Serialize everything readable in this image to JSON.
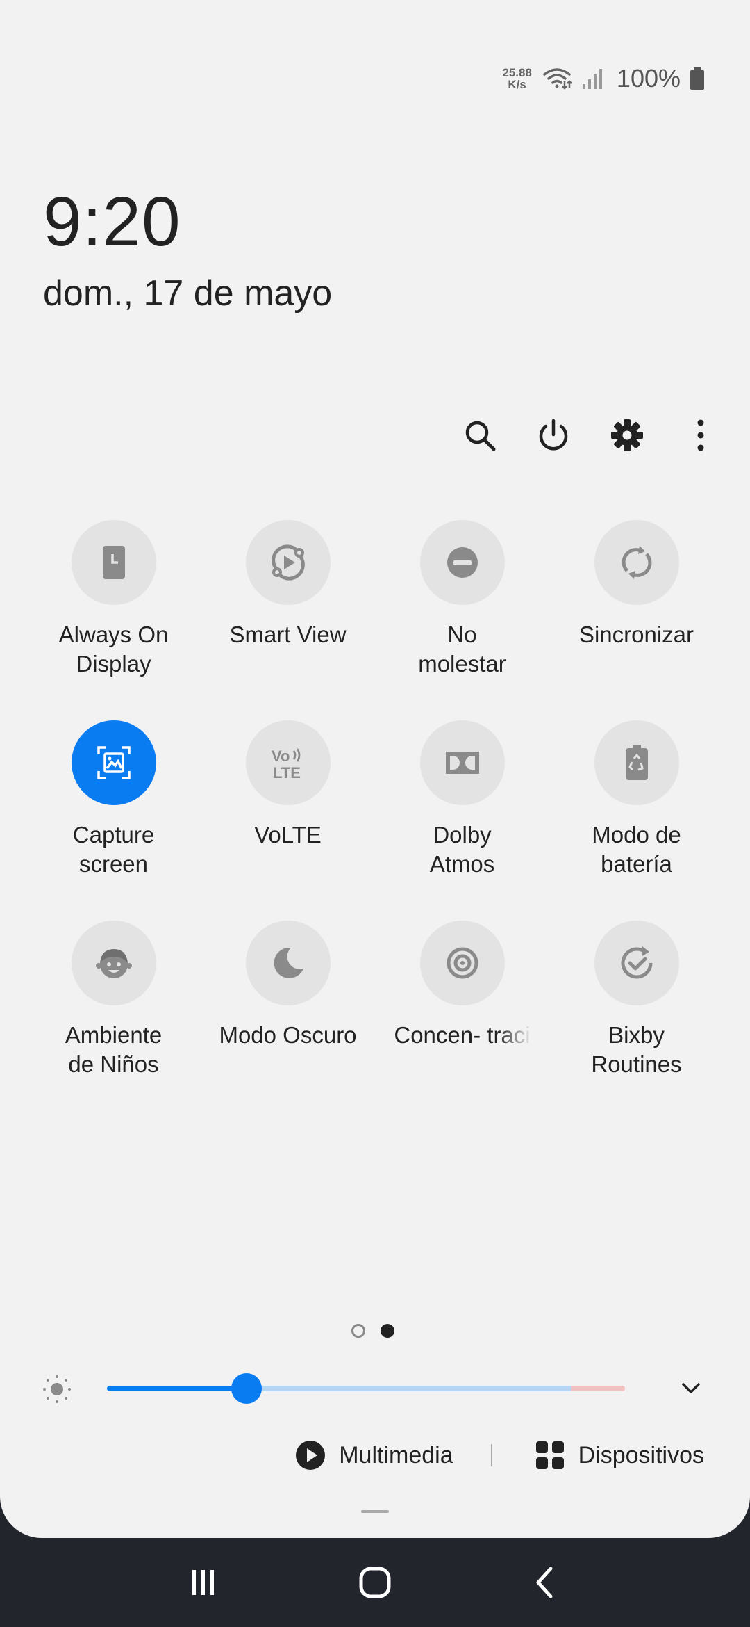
{
  "status_bar": {
    "net_speed_value": "25.88",
    "net_speed_unit": "K/s",
    "battery": "100%",
    "icons": [
      "wifi-icon",
      "signal-icon",
      "battery-icon"
    ]
  },
  "clock": {
    "time": "9:20",
    "date": "dom., 17 de mayo"
  },
  "toolbar": {
    "icons": [
      "search-icon",
      "power-icon",
      "settings-icon",
      "more-icon"
    ]
  },
  "tiles": [
    {
      "label": "Always On\nDisplay",
      "icon": "always-on-display-icon",
      "active": false
    },
    {
      "label": "Smart View",
      "icon": "smart-view-icon",
      "active": false
    },
    {
      "label": "No\nmolestar",
      "icon": "do-not-disturb-icon",
      "active": false
    },
    {
      "label": "Sincronizar",
      "icon": "sync-icon",
      "active": false
    },
    {
      "label": "Capture\nscreen",
      "icon": "capture-screen-icon",
      "active": true
    },
    {
      "label": "VoLTE",
      "icon": "volte-icon",
      "active": false
    },
    {
      "label": "Dolby\nAtmos",
      "icon": "dolby-atmos-icon",
      "active": false
    },
    {
      "label": "Modo de\nbatería",
      "icon": "battery-mode-icon",
      "active": false
    },
    {
      "label": "Ambiente\nde Niños",
      "icon": "kids-mode-icon",
      "active": false
    },
    {
      "label": "Modo Oscuro",
      "icon": "dark-mode-icon",
      "active": false
    },
    {
      "label": "Concen- traci",
      "icon": "focus-mode-icon",
      "active": false
    },
    {
      "label": "Bixby\nRoutines",
      "icon": "bixby-routines-icon",
      "active": false
    }
  ],
  "pager": {
    "pages": 2,
    "current": 2
  },
  "brightness": {
    "level": 0.27
  },
  "media": {
    "multimedia_label": "Multimedia",
    "devices_label": "Dispositivos"
  },
  "colors": {
    "accent": "#0a7cf2",
    "panel_bg": "#f2f2f2",
    "tile_bg": "#e3e3e3",
    "nav_bg": "#22252c"
  }
}
